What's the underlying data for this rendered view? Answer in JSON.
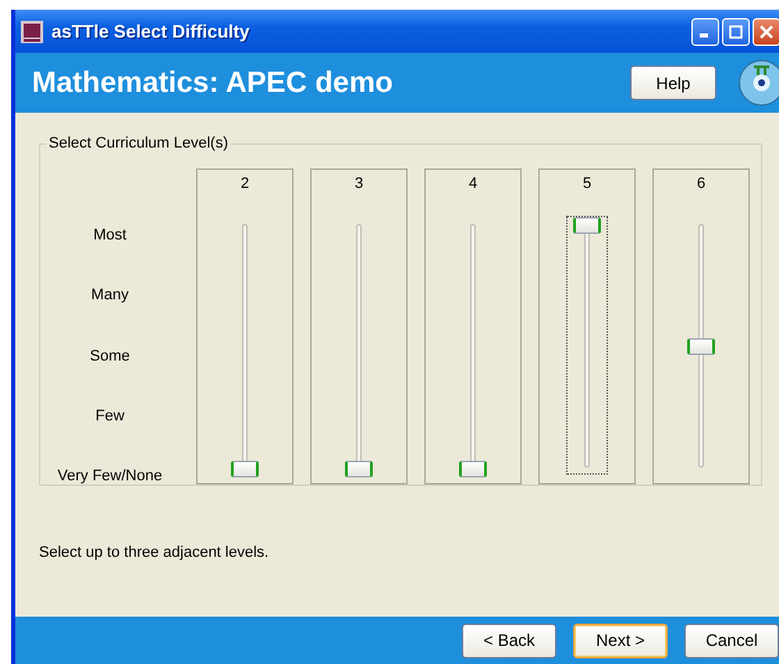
{
  "window": {
    "title": "asTTle Select Difficulty"
  },
  "header": {
    "title": "Mathematics: APEC demo",
    "help_button": "Help"
  },
  "group": {
    "title": "Select Curriculum Level(s)",
    "scale_labels": [
      "Most",
      "Many",
      "Some",
      "Few",
      "Very Few/None"
    ],
    "sliders": [
      {
        "label": "2",
        "level": 0,
        "focused": false
      },
      {
        "label": "3",
        "level": 0,
        "focused": false
      },
      {
        "label": "4",
        "level": 0,
        "focused": false
      },
      {
        "label": "5",
        "level": 1,
        "focused": true
      },
      {
        "label": "6",
        "level": 0.5,
        "focused": false
      }
    ]
  },
  "hint": "Select up to three adjacent levels.",
  "buttons": [
    {
      "label": "< Back",
      "default": false
    },
    {
      "label": "Next >",
      "default": true
    },
    {
      "label": "Cancel",
      "default": false
    }
  ]
}
